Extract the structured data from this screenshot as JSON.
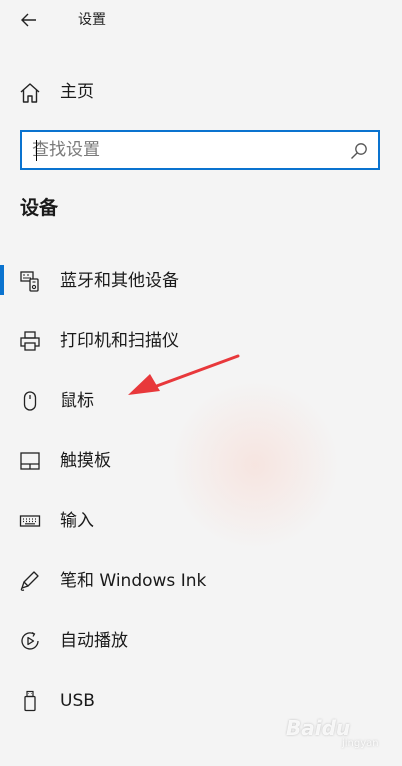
{
  "window": {
    "title": "设置"
  },
  "home": {
    "label": "主页",
    "icon": "home-icon"
  },
  "search": {
    "placeholder": "查找设置",
    "value": ""
  },
  "section": {
    "heading": "设备"
  },
  "nav": {
    "items": [
      {
        "label": "蓝牙和其他设备",
        "icon": "bluetooth-devices-icon",
        "selected": true
      },
      {
        "label": "打印机和扫描仪",
        "icon": "printer-icon",
        "selected": false
      },
      {
        "label": "鼠标",
        "icon": "mouse-icon",
        "selected": false
      },
      {
        "label": "触摸板",
        "icon": "touchpad-icon",
        "selected": false
      },
      {
        "label": "输入",
        "icon": "keyboard-icon",
        "selected": false
      },
      {
        "label": "笔和 Windows Ink",
        "icon": "pen-icon",
        "selected": false
      },
      {
        "label": "自动播放",
        "icon": "autoplay-icon",
        "selected": false
      },
      {
        "label": "USB",
        "icon": "usb-icon",
        "selected": false
      }
    ]
  },
  "colors": {
    "accent": "#0a73cf",
    "annotation_arrow": "#e8383b"
  },
  "watermark": {
    "text": "Baidu",
    "sub": "jingyan"
  }
}
